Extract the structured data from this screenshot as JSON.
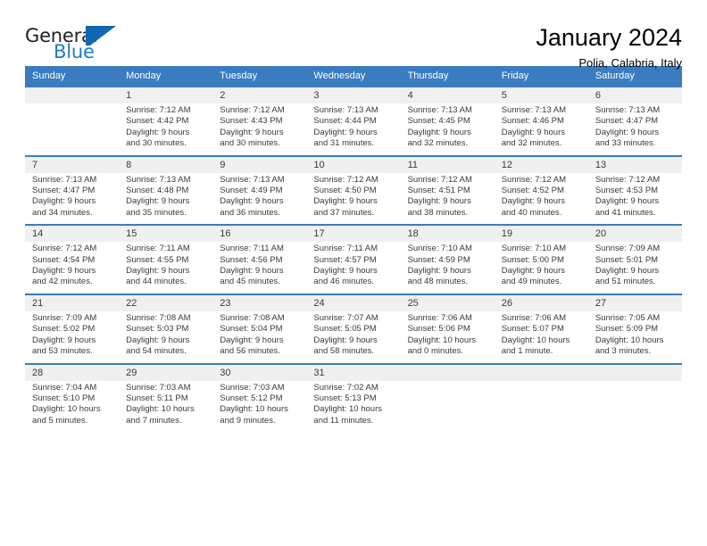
{
  "brand": {
    "name_part1": "General",
    "name_part2": "Blue",
    "mark": "blue-flag-mark",
    "accent_color": "#1e7ac4"
  },
  "header": {
    "title": "January 2024",
    "subtitle": "Polia, Calabria, Italy"
  },
  "theme": {
    "header_bg": "#3b7cc0",
    "daynum_bg": "#f0f0f0",
    "text": "#3a3a3a"
  },
  "calendar": {
    "weekday_headers": [
      "Sunday",
      "Monday",
      "Tuesday",
      "Wednesday",
      "Thursday",
      "Friday",
      "Saturday"
    ],
    "weeks": [
      {
        "days": [
          {
            "num": "",
            "empty": true,
            "sunrise": "",
            "sunset": "",
            "daylight1": "",
            "daylight2": ""
          },
          {
            "num": "1",
            "empty": false,
            "sunrise": "Sunrise: 7:12 AM",
            "sunset": "Sunset: 4:42 PM",
            "daylight1": "Daylight: 9 hours",
            "daylight2": "and 30 minutes."
          },
          {
            "num": "2",
            "empty": false,
            "sunrise": "Sunrise: 7:12 AM",
            "sunset": "Sunset: 4:43 PM",
            "daylight1": "Daylight: 9 hours",
            "daylight2": "and 30 minutes."
          },
          {
            "num": "3",
            "empty": false,
            "sunrise": "Sunrise: 7:13 AM",
            "sunset": "Sunset: 4:44 PM",
            "daylight1": "Daylight: 9 hours",
            "daylight2": "and 31 minutes."
          },
          {
            "num": "4",
            "empty": false,
            "sunrise": "Sunrise: 7:13 AM",
            "sunset": "Sunset: 4:45 PM",
            "daylight1": "Daylight: 9 hours",
            "daylight2": "and 32 minutes."
          },
          {
            "num": "5",
            "empty": false,
            "sunrise": "Sunrise: 7:13 AM",
            "sunset": "Sunset: 4:46 PM",
            "daylight1": "Daylight: 9 hours",
            "daylight2": "and 32 minutes."
          },
          {
            "num": "6",
            "empty": false,
            "sunrise": "Sunrise: 7:13 AM",
            "sunset": "Sunset: 4:47 PM",
            "daylight1": "Daylight: 9 hours",
            "daylight2": "and 33 minutes."
          }
        ]
      },
      {
        "days": [
          {
            "num": "7",
            "empty": false,
            "sunrise": "Sunrise: 7:13 AM",
            "sunset": "Sunset: 4:47 PM",
            "daylight1": "Daylight: 9 hours",
            "daylight2": "and 34 minutes."
          },
          {
            "num": "8",
            "empty": false,
            "sunrise": "Sunrise: 7:13 AM",
            "sunset": "Sunset: 4:48 PM",
            "daylight1": "Daylight: 9 hours",
            "daylight2": "and 35 minutes."
          },
          {
            "num": "9",
            "empty": false,
            "sunrise": "Sunrise: 7:13 AM",
            "sunset": "Sunset: 4:49 PM",
            "daylight1": "Daylight: 9 hours",
            "daylight2": "and 36 minutes."
          },
          {
            "num": "10",
            "empty": false,
            "sunrise": "Sunrise: 7:12 AM",
            "sunset": "Sunset: 4:50 PM",
            "daylight1": "Daylight: 9 hours",
            "daylight2": "and 37 minutes."
          },
          {
            "num": "11",
            "empty": false,
            "sunrise": "Sunrise: 7:12 AM",
            "sunset": "Sunset: 4:51 PM",
            "daylight1": "Daylight: 9 hours",
            "daylight2": "and 38 minutes."
          },
          {
            "num": "12",
            "empty": false,
            "sunrise": "Sunrise: 7:12 AM",
            "sunset": "Sunset: 4:52 PM",
            "daylight1": "Daylight: 9 hours",
            "daylight2": "and 40 minutes."
          },
          {
            "num": "13",
            "empty": false,
            "sunrise": "Sunrise: 7:12 AM",
            "sunset": "Sunset: 4:53 PM",
            "daylight1": "Daylight: 9 hours",
            "daylight2": "and 41 minutes."
          }
        ]
      },
      {
        "days": [
          {
            "num": "14",
            "empty": false,
            "sunrise": "Sunrise: 7:12 AM",
            "sunset": "Sunset: 4:54 PM",
            "daylight1": "Daylight: 9 hours",
            "daylight2": "and 42 minutes."
          },
          {
            "num": "15",
            "empty": false,
            "sunrise": "Sunrise: 7:11 AM",
            "sunset": "Sunset: 4:55 PM",
            "daylight1": "Daylight: 9 hours",
            "daylight2": "and 44 minutes."
          },
          {
            "num": "16",
            "empty": false,
            "sunrise": "Sunrise: 7:11 AM",
            "sunset": "Sunset: 4:56 PM",
            "daylight1": "Daylight: 9 hours",
            "daylight2": "and 45 minutes."
          },
          {
            "num": "17",
            "empty": false,
            "sunrise": "Sunrise: 7:11 AM",
            "sunset": "Sunset: 4:57 PM",
            "daylight1": "Daylight: 9 hours",
            "daylight2": "and 46 minutes."
          },
          {
            "num": "18",
            "empty": false,
            "sunrise": "Sunrise: 7:10 AM",
            "sunset": "Sunset: 4:59 PM",
            "daylight1": "Daylight: 9 hours",
            "daylight2": "and 48 minutes."
          },
          {
            "num": "19",
            "empty": false,
            "sunrise": "Sunrise: 7:10 AM",
            "sunset": "Sunset: 5:00 PM",
            "daylight1": "Daylight: 9 hours",
            "daylight2": "and 49 minutes."
          },
          {
            "num": "20",
            "empty": false,
            "sunrise": "Sunrise: 7:09 AM",
            "sunset": "Sunset: 5:01 PM",
            "daylight1": "Daylight: 9 hours",
            "daylight2": "and 51 minutes."
          }
        ]
      },
      {
        "days": [
          {
            "num": "21",
            "empty": false,
            "sunrise": "Sunrise: 7:09 AM",
            "sunset": "Sunset: 5:02 PM",
            "daylight1": "Daylight: 9 hours",
            "daylight2": "and 53 minutes."
          },
          {
            "num": "22",
            "empty": false,
            "sunrise": "Sunrise: 7:08 AM",
            "sunset": "Sunset: 5:03 PM",
            "daylight1": "Daylight: 9 hours",
            "daylight2": "and 54 minutes."
          },
          {
            "num": "23",
            "empty": false,
            "sunrise": "Sunrise: 7:08 AM",
            "sunset": "Sunset: 5:04 PM",
            "daylight1": "Daylight: 9 hours",
            "daylight2": "and 56 minutes."
          },
          {
            "num": "24",
            "empty": false,
            "sunrise": "Sunrise: 7:07 AM",
            "sunset": "Sunset: 5:05 PM",
            "daylight1": "Daylight: 9 hours",
            "daylight2": "and 58 minutes."
          },
          {
            "num": "25",
            "empty": false,
            "sunrise": "Sunrise: 7:06 AM",
            "sunset": "Sunset: 5:06 PM",
            "daylight1": "Daylight: 10 hours",
            "daylight2": "and 0 minutes."
          },
          {
            "num": "26",
            "empty": false,
            "sunrise": "Sunrise: 7:06 AM",
            "sunset": "Sunset: 5:07 PM",
            "daylight1": "Daylight: 10 hours",
            "daylight2": "and 1 minute."
          },
          {
            "num": "27",
            "empty": false,
            "sunrise": "Sunrise: 7:05 AM",
            "sunset": "Sunset: 5:09 PM",
            "daylight1": "Daylight: 10 hours",
            "daylight2": "and 3 minutes."
          }
        ]
      },
      {
        "days": [
          {
            "num": "28",
            "empty": false,
            "sunrise": "Sunrise: 7:04 AM",
            "sunset": "Sunset: 5:10 PM",
            "daylight1": "Daylight: 10 hours",
            "daylight2": "and 5 minutes."
          },
          {
            "num": "29",
            "empty": false,
            "sunrise": "Sunrise: 7:03 AM",
            "sunset": "Sunset: 5:11 PM",
            "daylight1": "Daylight: 10 hours",
            "daylight2": "and 7 minutes."
          },
          {
            "num": "30",
            "empty": false,
            "sunrise": "Sunrise: 7:03 AM",
            "sunset": "Sunset: 5:12 PM",
            "daylight1": "Daylight: 10 hours",
            "daylight2": "and 9 minutes."
          },
          {
            "num": "31",
            "empty": false,
            "sunrise": "Sunrise: 7:02 AM",
            "sunset": "Sunset: 5:13 PM",
            "daylight1": "Daylight: 10 hours",
            "daylight2": "and 11 minutes."
          },
          {
            "num": "",
            "empty": true,
            "sunrise": "",
            "sunset": "",
            "daylight1": "",
            "daylight2": ""
          },
          {
            "num": "",
            "empty": true,
            "sunrise": "",
            "sunset": "",
            "daylight1": "",
            "daylight2": ""
          },
          {
            "num": "",
            "empty": true,
            "sunrise": "",
            "sunset": "",
            "daylight1": "",
            "daylight2": ""
          }
        ]
      }
    ]
  }
}
